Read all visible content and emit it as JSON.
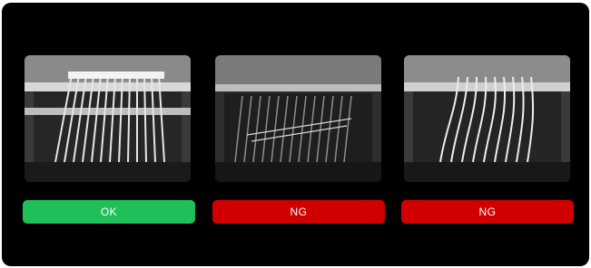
{
  "inspections": [
    {
      "result": "OK",
      "status_color": "#1fbf5a"
    },
    {
      "result": "NG",
      "status_color": "#d00000"
    },
    {
      "result": "NG",
      "status_color": "#d00000"
    }
  ]
}
